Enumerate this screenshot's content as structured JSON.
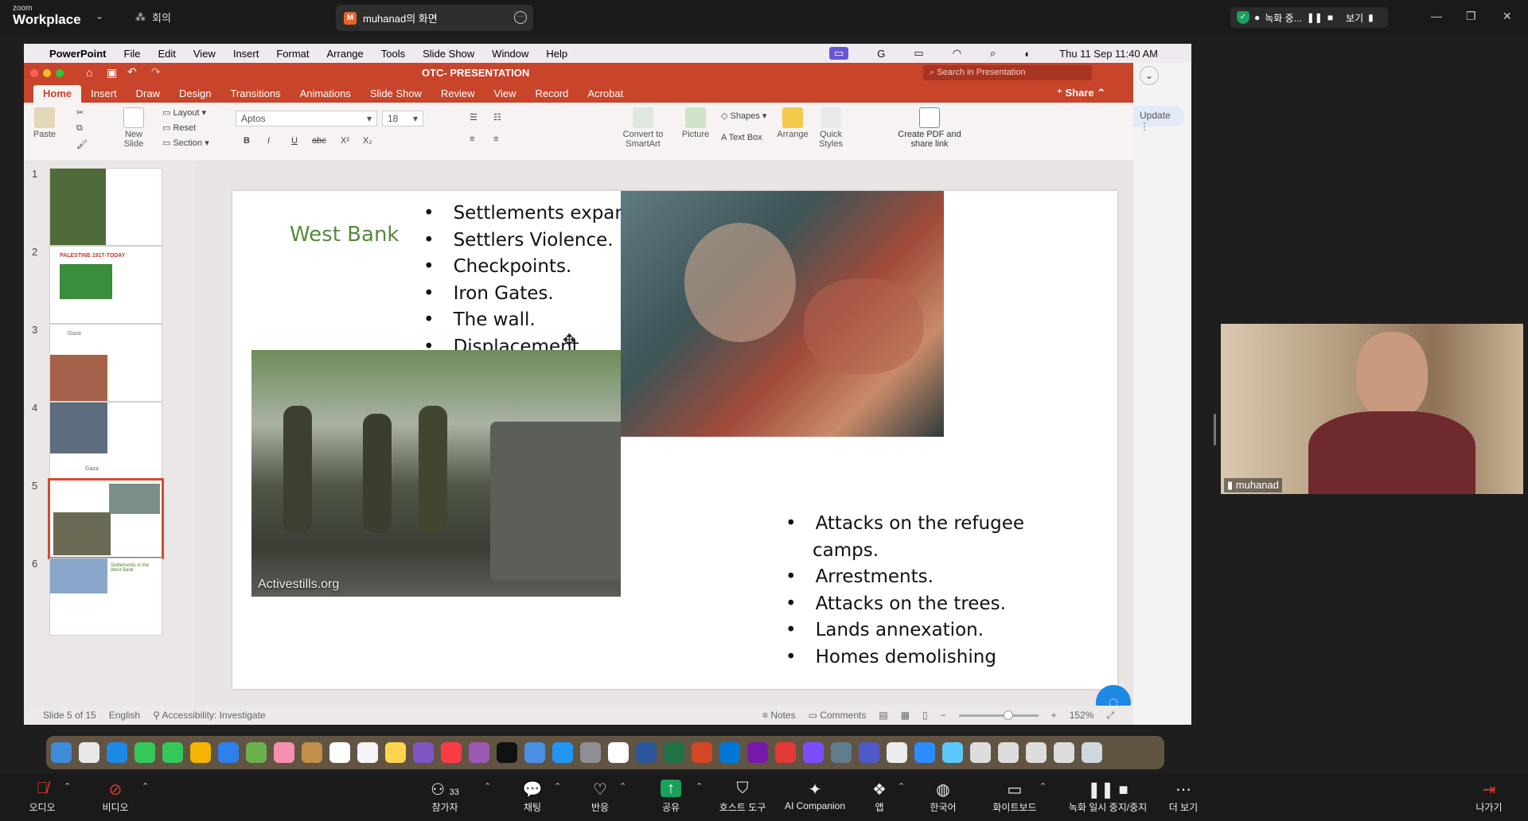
{
  "zoom": {
    "logo_small": "zoom",
    "logo_big": "Workplace",
    "meeting_tab": "회의",
    "share_badge": "M",
    "share_tab": "muhanad의 화면",
    "recording": "녹화 중...",
    "view": "보기"
  },
  "mac": {
    "app": "PowerPoint",
    "menus": [
      "File",
      "Edit",
      "View",
      "Insert",
      "Format",
      "Arrange",
      "Tools",
      "Slide Show",
      "Window",
      "Help"
    ],
    "clock": "Thu 11 Sep  11:40 AM"
  },
  "ppt": {
    "doc_title": "OTC- PRESENTATION",
    "search_placeholder": "Search in Presentation",
    "share": "Share",
    "update": "Update",
    "tabs": [
      "Home",
      "Insert",
      "Draw",
      "Design",
      "Transitions",
      "Animations",
      "Slide Show",
      "Review",
      "View",
      "Record",
      "Acrobat"
    ],
    "ribbon": {
      "paste": "Paste",
      "new_slide": "New Slide",
      "layout": "Layout",
      "reset": "Reset",
      "section": "Section",
      "font": "Aptos",
      "size": "18",
      "convert": "Convert to SmartArt",
      "picture": "Picture",
      "shapes": "Shapes",
      "text_box": "Text Box",
      "arrange": "Arrange",
      "quick_styles": "Quick Styles",
      "create_pdf": "Create PDF and share link"
    },
    "thumb_numbers": [
      "1",
      "2",
      "3",
      "4",
      "5",
      "6"
    ],
    "thumb_texts": {
      "t2_title": "PALESTINE 1917-TODAY",
      "t3_title": "Gaza",
      "t4_title": "Gaza",
      "t6_title": "Settlements in the West Bank"
    },
    "slide": {
      "title": "West Bank",
      "bullets_top": [
        "Settlements expansions.",
        "Settlers Violence.",
        "Checkpoints.",
        "Iron Gates.",
        "The wall.",
        "Displacement."
      ],
      "bullets_bottom": [
        "Attacks on the refugee camps.",
        "Arrestments.",
        "Attacks on the trees.",
        "Lands annexation.",
        "Homes demolishing"
      ],
      "photo_credit": "Activestills.org"
    },
    "status": {
      "slide_of": "Slide 5 of 15",
      "language": "English",
      "accessibility": "Accessibility: Investigate",
      "notes": "Notes",
      "comments": "Comments",
      "zoom": "152%"
    }
  },
  "video": {
    "participant": "muhanad"
  },
  "toolbar": {
    "audio": "오디오",
    "video": "비디오",
    "participants": "참가자",
    "participants_count": "33",
    "chat": "채팅",
    "reactions": "반응",
    "share": "공유",
    "host_tools": "호스트 도구",
    "ai_companion": "AI Companion",
    "apps": "앱",
    "korean": "한국어",
    "whiteboard": "화이트보드",
    "record_pause": "녹화 일시 중지/중지",
    "more": "더 보기",
    "leave": "나가기"
  }
}
